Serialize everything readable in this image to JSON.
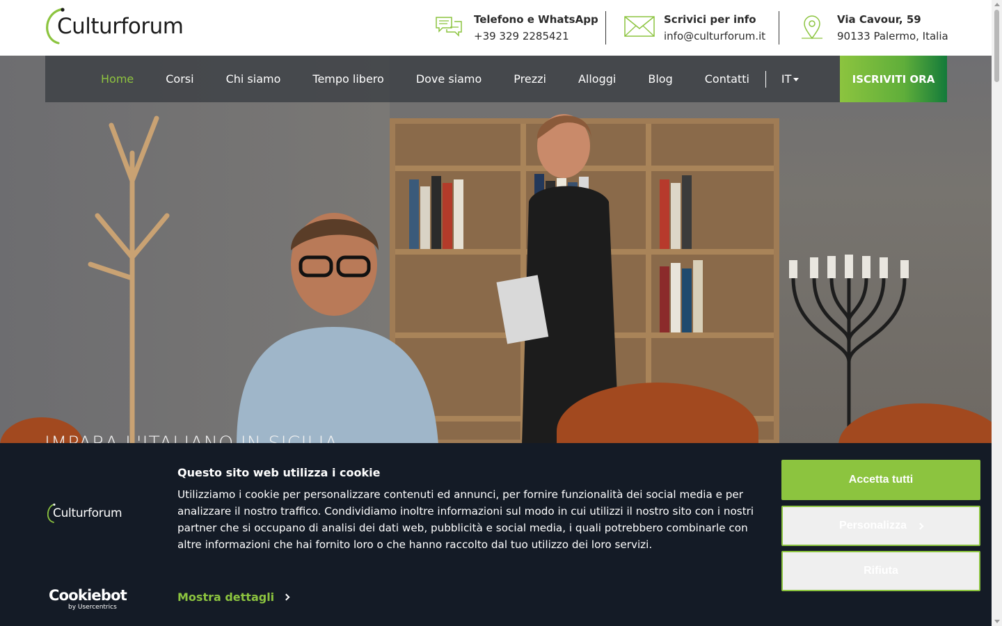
{
  "brand": {
    "name": "Culturforum",
    "accent": "#8cc43f"
  },
  "header": {
    "phone": {
      "title": "Telefono e WhatsApp",
      "value": "+39 329 2285421",
      "icon": "chat-icon"
    },
    "email": {
      "title": "Scrivici per info",
      "value": "info@culturforum.it",
      "icon": "mail-icon"
    },
    "address": {
      "title": "Via Cavour, 59",
      "value": "90133 Palermo, Italia",
      "icon": "location-pin-icon"
    }
  },
  "nav": {
    "items": [
      {
        "label": "Home",
        "active": true
      },
      {
        "label": "Corsi"
      },
      {
        "label": "Chi siamo"
      },
      {
        "label": "Tempo libero"
      },
      {
        "label": "Dove siamo"
      },
      {
        "label": "Prezzi"
      },
      {
        "label": "Alloggi"
      },
      {
        "label": "Blog"
      },
      {
        "label": "Contatti"
      }
    ],
    "language": "IT",
    "cta": "ISCRIVITI ORA"
  },
  "hero": {
    "title": "IMPARA L'ITALIANO IN SICILIA"
  },
  "cookie_banner": {
    "logo_text": "Culturforum",
    "title": "Questo sito web utilizza i cookie",
    "body": "Utilizziamo i cookie per personalizzare contenuti ed annunci, per fornire funzionalità dei social media e per analizzare il nostro traffico. Condividiamo inoltre informazioni sul modo in cui utilizzi il nostro sito con i nostri partner che si occupano di analisi dei dati web, pubblicità e social media, i quali potrebbero combinarle con altre informazioni che hai fornito loro o che hanno raccolto dal tuo utilizzo dei loro servizi.",
    "details_link": "Mostra dettagli",
    "buttons": {
      "accept": "Accetta tutti",
      "customize": "Personalizza",
      "reject": "Rifiuta"
    },
    "cookiebot": {
      "brand": "Cookiebot",
      "sub": "by Usercentrics"
    }
  }
}
